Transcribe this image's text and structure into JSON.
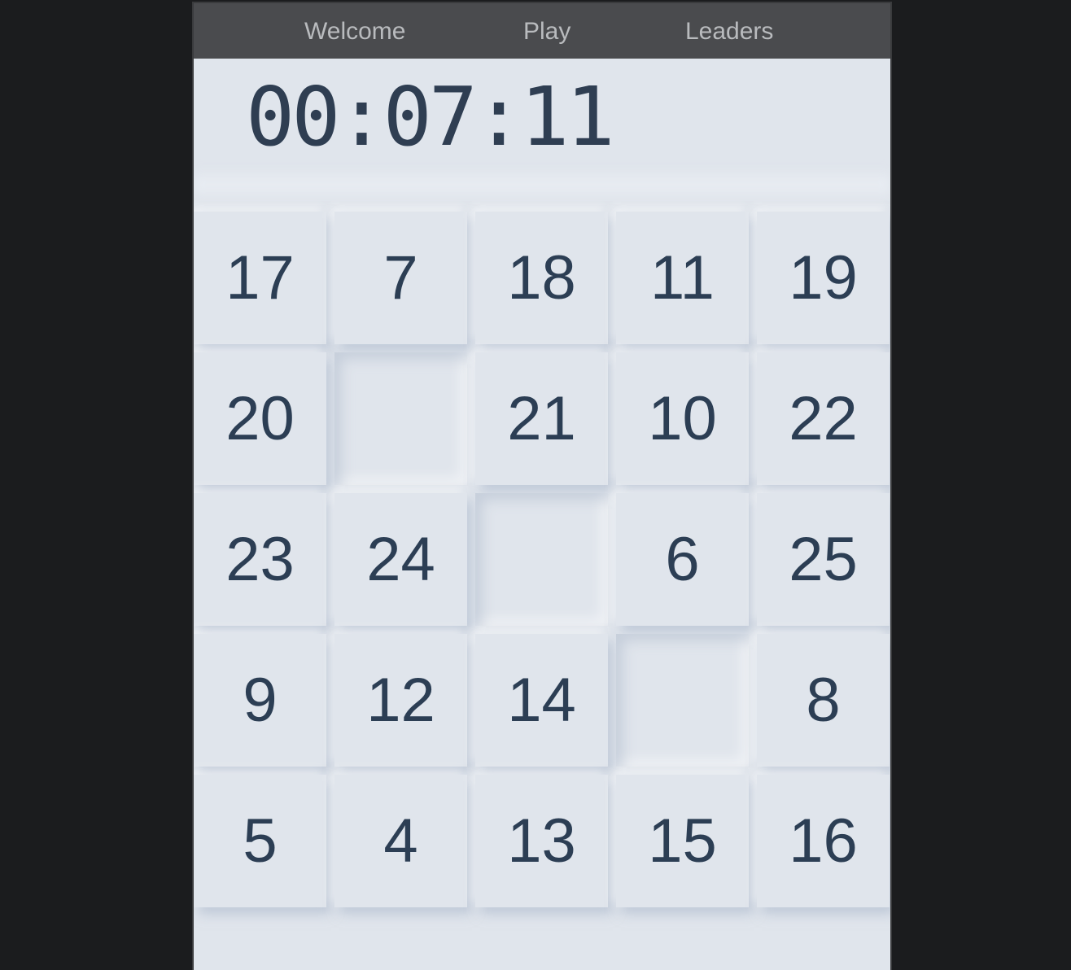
{
  "nav": {
    "items": [
      {
        "label": "Welcome"
      },
      {
        "label": "Play"
      },
      {
        "label": "Leaders"
      }
    ]
  },
  "timer": {
    "value": "00:07:11"
  },
  "board": {
    "rows": 5,
    "cols": 5,
    "tiles": [
      "17",
      "7",
      "18",
      "11",
      "19",
      "20",
      "",
      "21",
      "10",
      "22",
      "23",
      "24",
      "",
      "6",
      "25",
      "9",
      "12",
      "14",
      "",
      "8",
      "5",
      "4",
      "13",
      "15",
      "16"
    ]
  },
  "colors": {
    "background": "#1b1c1e",
    "panel": "#e0e5ec",
    "nav": "#4a4b4e",
    "text": "#2c3e54",
    "nav_text": "#b9bbbe"
  }
}
